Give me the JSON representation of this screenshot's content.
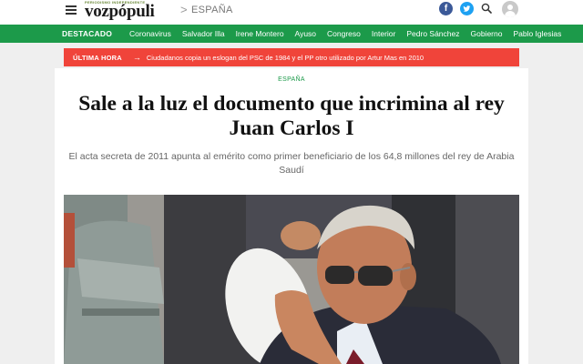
{
  "header": {
    "logo_tagline": "PERIODISMO INDEPENDIENTE",
    "logo_text": "vozpópuli",
    "breadcrumb_separator": ">",
    "breadcrumb": "ESPAÑA",
    "facebook_glyph": "f",
    "twitter_glyph": "t",
    "icons": [
      "menu-icon",
      "facebook-icon",
      "twitter-icon",
      "search-icon",
      "user-avatar-icon"
    ]
  },
  "nav": {
    "featured_label": "DESTACADO",
    "items": [
      "Coronavirus",
      "Salvador Illa",
      "Irene Montero",
      "Ayuso",
      "Congreso",
      "Interior",
      "Pedro Sánchez",
      "Gobierno",
      "Pablo Iglesias"
    ]
  },
  "breaking": {
    "label": "ÚLTIMA HORA",
    "arrow": "→",
    "text": "Ciudadanos copia un eslogan del PSC de 1984 y el PP otro utilizado por Artur Mas en 2010"
  },
  "article": {
    "section": "ESPAÑA",
    "headline": "Sale a la luz el documento que incrimina al rey Juan Carlos I",
    "subtitle": "El acta secreta de 2011 apunta al emérito como primer beneficiario de los 64,8 millones del rey de Arabia Saudí"
  },
  "colors": {
    "nav_green": "#1c9a4a",
    "breaking_red": "#f0443a",
    "facebook_blue": "#3b5998",
    "twitter_blue": "#1da1f2"
  }
}
